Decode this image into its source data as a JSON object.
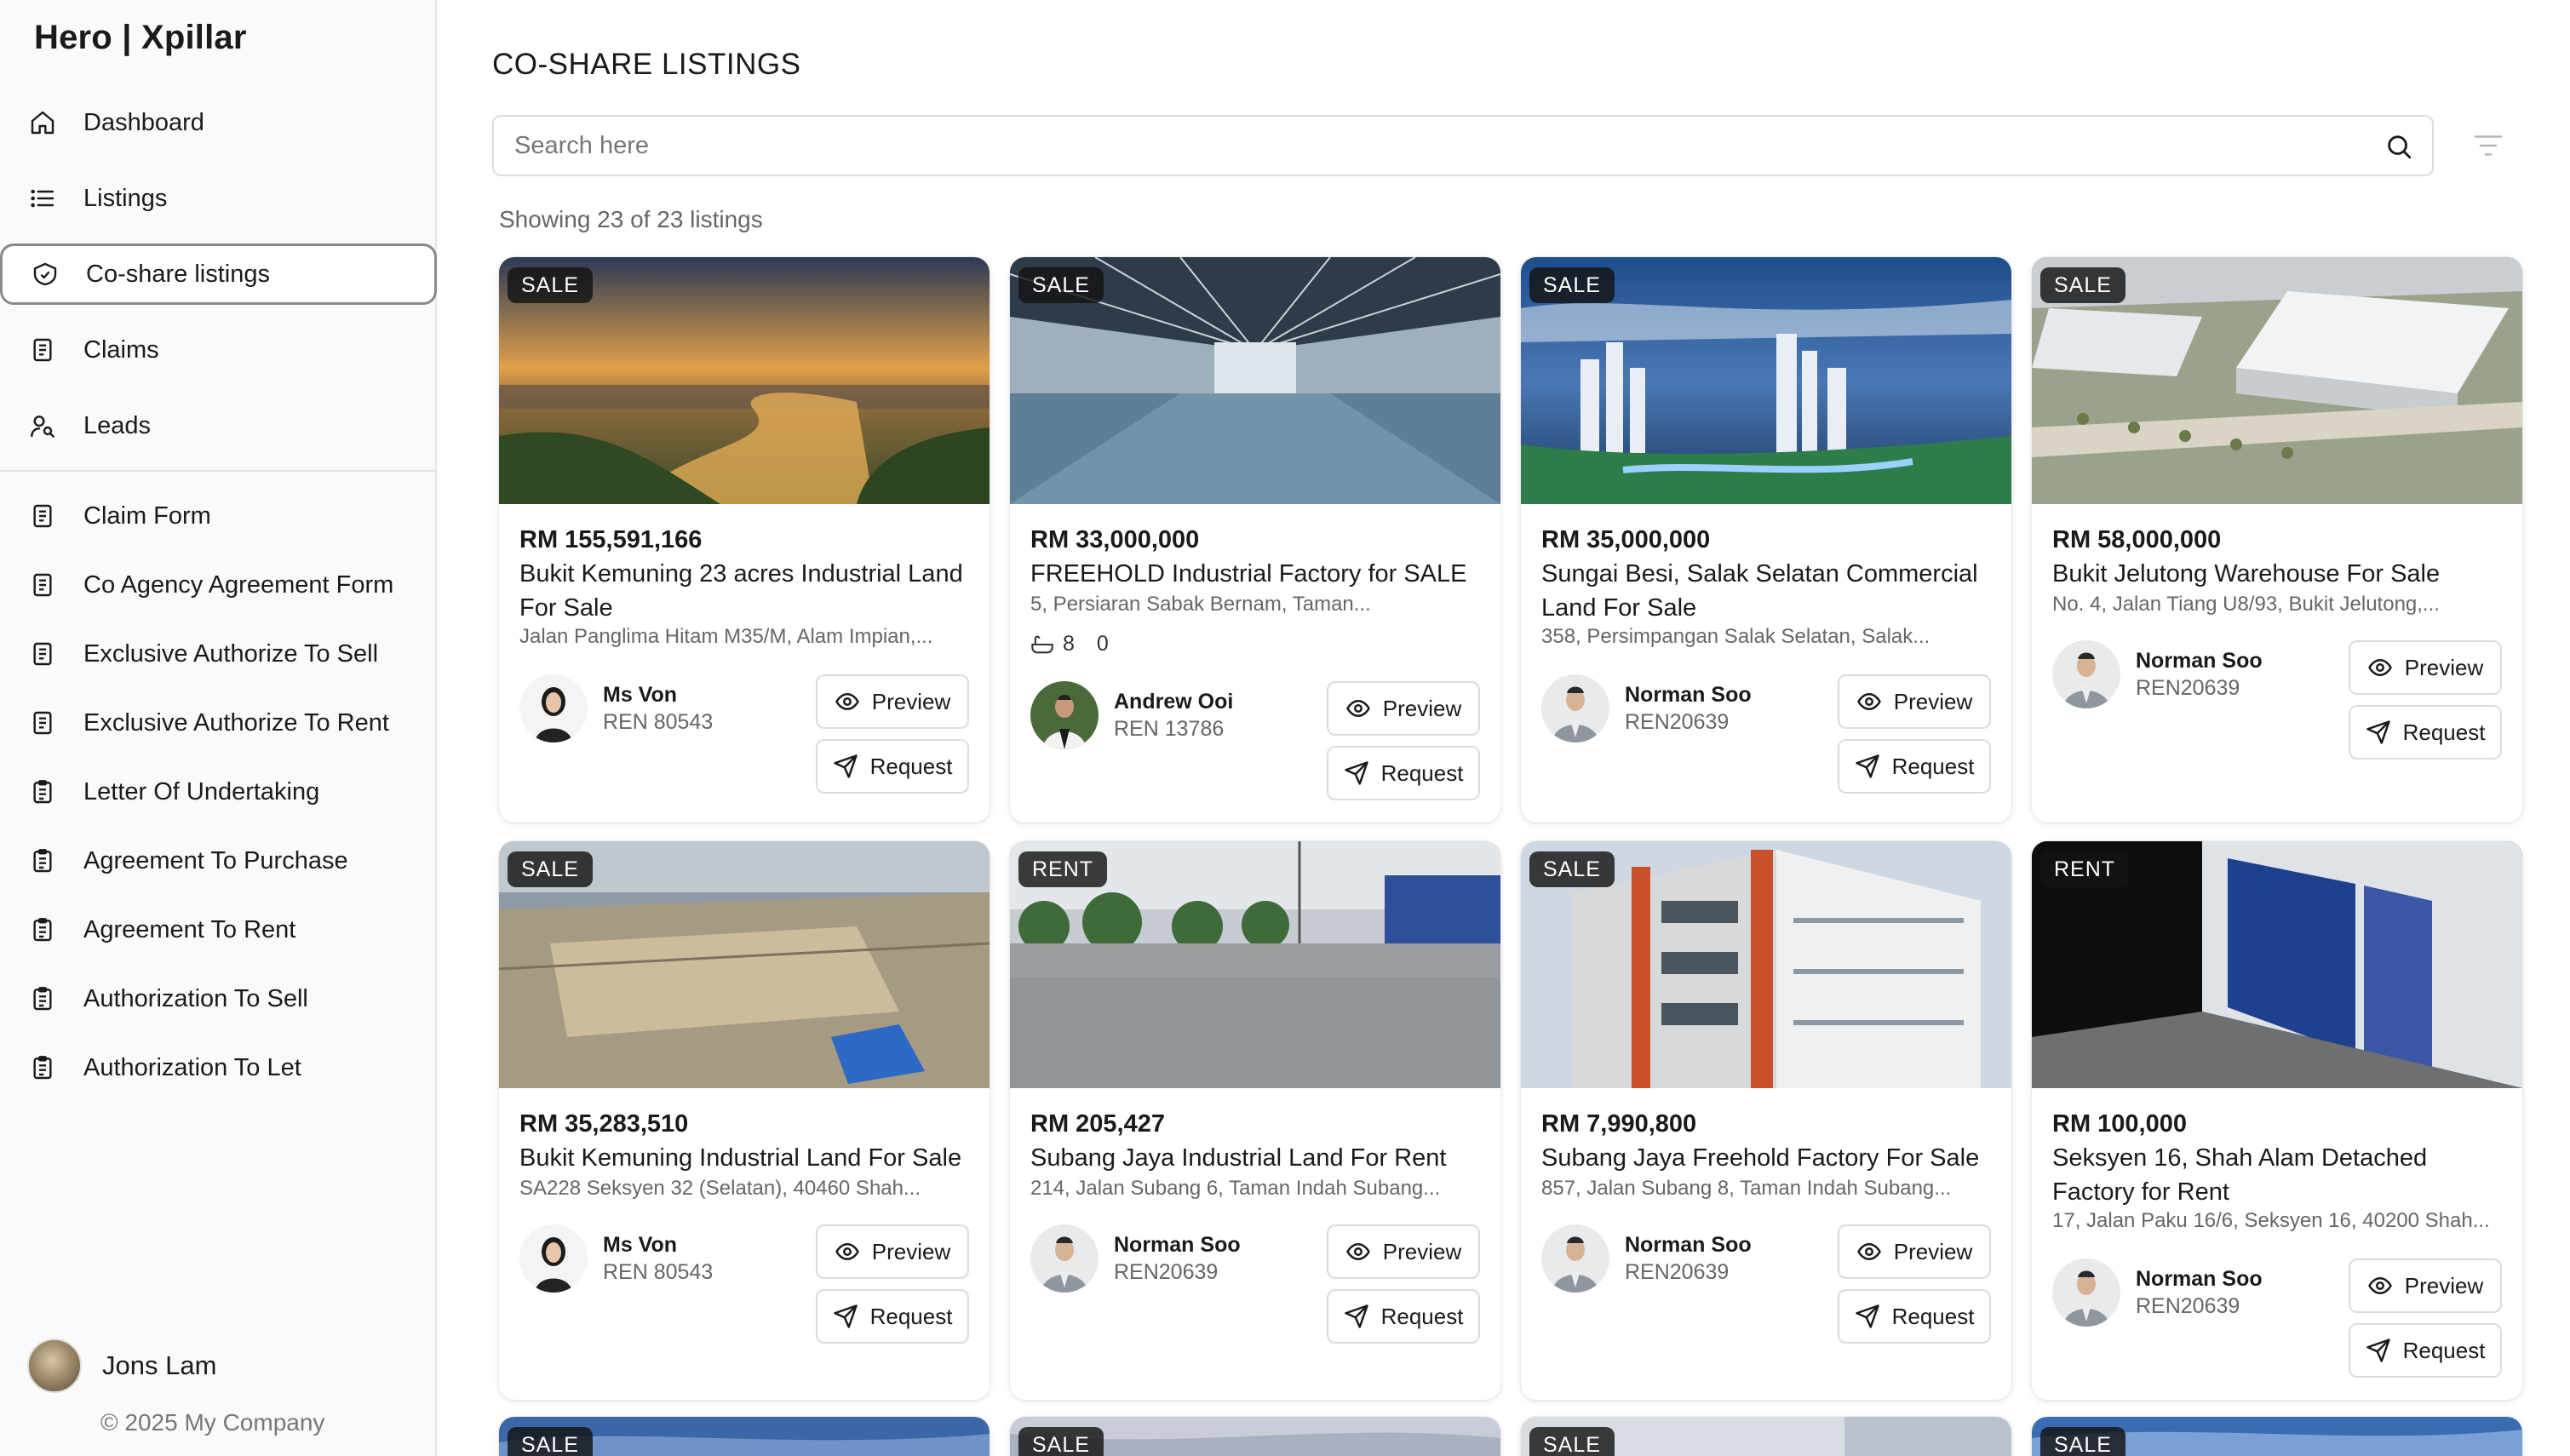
{
  "app": {
    "brand": "Hero | Xpillar"
  },
  "sidebar": {
    "items": [
      {
        "label": "Dashboard",
        "icon": "home-icon"
      },
      {
        "label": "Listings",
        "icon": "list-icon"
      },
      {
        "label": "Co-share listings",
        "icon": "share-icon",
        "active": true
      },
      {
        "label": "Claims",
        "icon": "document-icon"
      },
      {
        "label": "Leads",
        "icon": "user-search-icon"
      }
    ],
    "forms": [
      {
        "label": "Claim Form",
        "icon": "file-icon"
      },
      {
        "label": "Co Agency Agreement Form",
        "icon": "file-icon"
      },
      {
        "label": "Exclusive Authorize To Sell",
        "icon": "file-icon"
      },
      {
        "label": "Exclusive Authorize To Rent",
        "icon": "file-icon"
      },
      {
        "label": "Letter Of Undertaking",
        "icon": "clipboard-icon"
      },
      {
        "label": "Agreement To Purchase",
        "icon": "clipboard-icon"
      },
      {
        "label": "Agreement To Rent",
        "icon": "clipboard-icon"
      },
      {
        "label": "Authorization To Sell",
        "icon": "clipboard-icon"
      },
      {
        "label": "Authorization To Let",
        "icon": "clipboard-icon"
      }
    ],
    "user": {
      "name": "Jons Lam"
    },
    "copyright": "© 2025 My Company"
  },
  "main": {
    "title": "CO-SHARE LISTINGS",
    "search": {
      "placeholder": "Search here",
      "value": ""
    },
    "showing": "Showing 23 of 23 listings",
    "buttons": {
      "preview": "Preview",
      "request": "Request"
    },
    "listings": [
      {
        "badge": "SALE",
        "price": "RM 155,591,166",
        "title": "Bukit Kemuning 23 acres Industrial Land For Sale",
        "address": "Jalan Panglima Hitam M35/M, Alam Impian,...",
        "agent": "Ms Von",
        "ren": "REN 80543"
      },
      {
        "badge": "SALE",
        "price": "RM 33,000,000",
        "title": "FREEHOLD Industrial Factory for SALE",
        "address": "5, Persiaran Sabak Bernam, Taman...",
        "baths": "8",
        "beds": "0",
        "agent": "Andrew Ooi",
        "ren": "REN 13786"
      },
      {
        "badge": "SALE",
        "price": "RM 35,000,000",
        "title": "Sungai Besi, Salak Selatan Commercial Land For Sale",
        "address": "358, Persimpangan Salak Selatan, Salak...",
        "agent": "Norman Soo",
        "ren": "REN20639"
      },
      {
        "badge": "SALE",
        "price": "RM 58,000,000",
        "title": "Bukit Jelutong Warehouse For Sale",
        "address": "No. 4, Jalan Tiang U8/93, Bukit Jelutong,...",
        "agent": "Norman Soo",
        "ren": "REN20639"
      },
      {
        "badge": "SALE",
        "price": "RM 35,283,510",
        "title": "Bukit Kemuning Industrial Land For Sale",
        "address": "SA228 Seksyen 32 (Selatan), 40460 Shah...",
        "agent": "Ms Von",
        "ren": "REN 80543"
      },
      {
        "badge": "RENT",
        "price": "RM 205,427",
        "title": "Subang Jaya Industrial Land For Rent",
        "address": "214, Jalan Subang 6, Taman Indah Subang...",
        "agent": "Norman Soo",
        "ren": "REN20639"
      },
      {
        "badge": "SALE",
        "price": "RM 7,990,800",
        "title": "Subang Jaya Freehold Factory For Sale",
        "address": "857, Jalan Subang 8, Taman Indah Subang...",
        "agent": "Norman Soo",
        "ren": "REN20639"
      },
      {
        "badge": "RENT",
        "price": "RM 100,000",
        "title": "Seksyen 16, Shah Alam Detached Factory for Rent",
        "address": "17, Jalan Paku 16/6, Seksyen 16, 40200 Shah...",
        "agent": "Norman Soo",
        "ren": "REN20639"
      },
      {
        "badge": "SALE"
      },
      {
        "badge": "SALE"
      },
      {
        "badge": "SALE"
      },
      {
        "badge": "SALE"
      }
    ]
  },
  "colors": {
    "text": "#1a1a1a",
    "muted": "#666666",
    "border": "#dcdcdc",
    "badge_bg": "#1f1f1f"
  }
}
